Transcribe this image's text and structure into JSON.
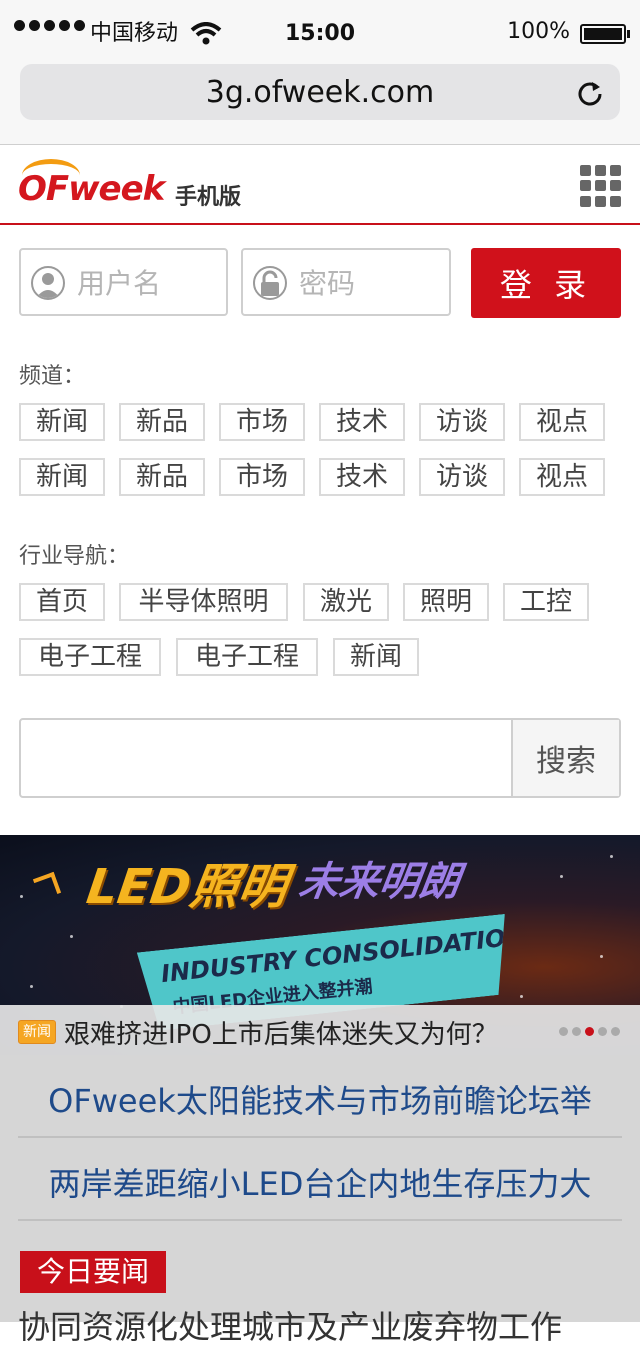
{
  "status_bar": {
    "carrier": "中国移动",
    "time": "15:00",
    "battery": "100%"
  },
  "browser": {
    "url": "3g.ofweek.com"
  },
  "header": {
    "logo_text": "OFweek",
    "subtitle": "手机版"
  },
  "login": {
    "username_placeholder": "用户名",
    "password_placeholder": "密码",
    "login_label": "登 录"
  },
  "channels": {
    "title": "频道：",
    "items": [
      "新闻",
      "新品",
      "市场",
      "技术",
      "访谈",
      "视点",
      "新闻",
      "新品",
      "市场",
      "技术",
      "访谈",
      "视点"
    ]
  },
  "industry": {
    "title": "行业导航：",
    "items": [
      "首页",
      "半导体照明",
      "激光",
      "照明",
      "工控",
      "电子工程",
      "电子工程",
      "新闻"
    ]
  },
  "search": {
    "button_label": "搜索"
  },
  "banner": {
    "title": "LED照明",
    "title_accent": "未来明朗",
    "ribbon_en": "INDUSTRY CONSOLIDATION",
    "ribbon_cn": "中国LED企业进入整并潮",
    "badge": "新闻",
    "caption": "艰难挤进IPO上市后集体迷失又为何？",
    "active_slide": 3,
    "slide_count": 5
  },
  "headlines": [
    "OFweek太阳能技术与市场前瞻论坛举",
    "两岸差距缩小LED台企内地生存压力大"
  ],
  "today": {
    "label": "今日要闻",
    "first_item_partial": "协同资源化处理城市及产业废弃物工作"
  },
  "colors": {
    "brand_red": "#c8101a",
    "link_blue": "#1e4a8a",
    "logo_orange": "#f39c12"
  }
}
